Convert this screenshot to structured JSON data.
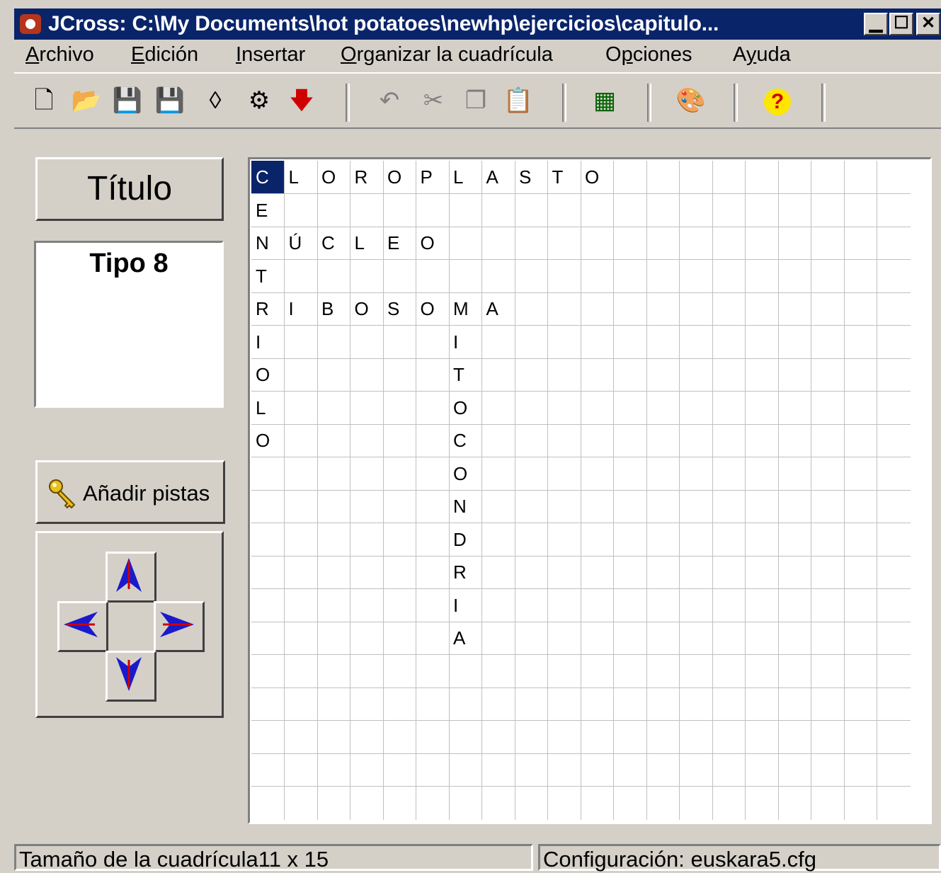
{
  "window": {
    "title": "JCross: C:\\My Documents\\hot potatoes\\newhp\\ejercicios\\capitulo...",
    "controls": {
      "minimize": "▁",
      "maximize": "☐",
      "close": "✕"
    }
  },
  "menu": [
    {
      "label": "Archivo",
      "hotkey_index": 0
    },
    {
      "label": "Edición",
      "hotkey_index": 0
    },
    {
      "label": "Insertar",
      "hotkey_index": 0
    },
    {
      "label": "Organizar la cuadrícula",
      "hotkey_index": 0
    },
    {
      "label": "Opciones",
      "hotkey_index": 1
    },
    {
      "label": "Ayuda",
      "hotkey_index": 1
    }
  ],
  "toolbar": {
    "buttons": [
      {
        "name": "new-file-icon",
        "glyph": "🗋"
      },
      {
        "name": "open-folder-icon",
        "glyph": "📂"
      },
      {
        "name": "save-icon",
        "glyph": "💾"
      },
      {
        "name": "save-as-icon",
        "glyph": "💾"
      },
      {
        "name": "view-in-browser-icon",
        "glyph": "◊"
      },
      {
        "name": "export-web-icon",
        "glyph": "⚙"
      },
      {
        "name": "add-down-arrow-icon",
        "glyph": "🡇"
      },
      {
        "name": "undo-icon",
        "glyph": "↶"
      },
      {
        "name": "cut-icon",
        "glyph": "✂"
      },
      {
        "name": "copy-icon",
        "glyph": "❐"
      },
      {
        "name": "paste-icon",
        "glyph": "📋"
      },
      {
        "name": "grid-maker-icon",
        "glyph": "▦"
      },
      {
        "name": "configure-output-icon",
        "glyph": "🎨"
      },
      {
        "name": "help-icon",
        "glyph": "?"
      }
    ]
  },
  "left_panel": {
    "title_button": "Título",
    "tipo_text": "Tipo 8",
    "add_clues_button": "Añadir pistas",
    "arrow_buttons": [
      "up",
      "left",
      "right",
      "down"
    ]
  },
  "grid": {
    "rows": 20,
    "cols": 20,
    "selected": {
      "row": 0,
      "col": 0
    },
    "letters": [
      [
        "C",
        "L",
        "O",
        "R",
        "O",
        "P",
        "L",
        "A",
        "S",
        "T",
        "O"
      ],
      [
        "E"
      ],
      [
        "N",
        "Ú",
        "C",
        "L",
        "E",
        "O"
      ],
      [
        "T"
      ],
      [
        "R",
        "I",
        "B",
        "O",
        "S",
        "O",
        "M",
        "A"
      ],
      [
        "I",
        "",
        "",
        "",
        "",
        "",
        "I"
      ],
      [
        "O",
        "",
        "",
        "",
        "",
        "",
        "T"
      ],
      [
        "L",
        "",
        "",
        "",
        "",
        "",
        "O"
      ],
      [
        "O",
        "",
        "",
        "",
        "",
        "",
        "C"
      ],
      [
        "",
        "",
        "",
        "",
        "",
        "",
        "O"
      ],
      [
        "",
        "",
        "",
        "",
        "",
        "",
        "N"
      ],
      [
        "",
        "",
        "",
        "",
        "",
        "",
        "D"
      ],
      [
        "",
        "",
        "",
        "",
        "",
        "",
        "R"
      ],
      [
        "",
        "",
        "",
        "",
        "",
        "",
        "I"
      ],
      [
        "",
        "",
        "",
        "",
        "",
        "",
        "A"
      ]
    ]
  },
  "status": {
    "left": "Tamaño de la cuadrícula11 x 15",
    "right": "Configuración: euskara5.cfg"
  },
  "colors": {
    "titlebar": "#0a246a",
    "face": "#d4d0c8",
    "selection": "#0a246a",
    "arrow_blue": "#1a1acc",
    "arrow_red": "#d00000"
  }
}
